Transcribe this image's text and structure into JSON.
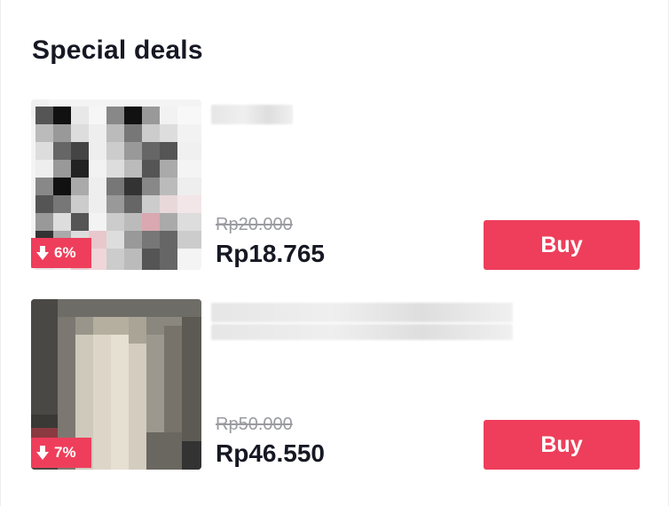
{
  "section": {
    "title": "Special deals"
  },
  "colors": {
    "accent": "#ee3e5b",
    "strike_price": "#9a9ba0"
  },
  "products": [
    {
      "discount": "6%",
      "original_price": "Rp20.000",
      "sale_price": "Rp18.765",
      "buy_label": "Buy",
      "discount_icon": "arrow-down-icon"
    },
    {
      "discount": "7%",
      "original_price": "Rp50.000",
      "sale_price": "Rp46.550",
      "buy_label": "Buy",
      "discount_icon": "arrow-down-icon"
    }
  ]
}
